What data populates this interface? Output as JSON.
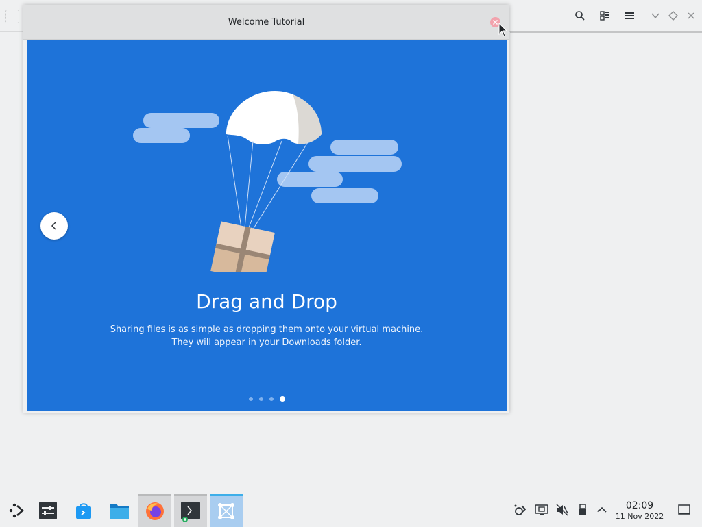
{
  "dialog": {
    "title": "Welcome Tutorial",
    "slide": {
      "title": "Drag and Drop",
      "description": "Sharing files is as simple as dropping them onto your virtual machine. They will appear in your Downloads folder."
    },
    "dots": {
      "count": 4,
      "active_index": 3
    }
  },
  "topbar": {
    "icons": [
      "search-icon",
      "grid-view-icon",
      "hamburger-menu-icon",
      "chevron-down-icon",
      "diamond-icon",
      "close-icon"
    ]
  },
  "taskbar": {
    "apps": [
      "application-launcher",
      "system-settings",
      "discover-store",
      "file-manager",
      "firefox",
      "terminal",
      "screenshot-tool"
    ],
    "clock": {
      "time": "02:09",
      "date": "11 Nov 2022"
    }
  },
  "colors": {
    "panel_blue": "#1e73d9",
    "cloud": "#a4c6f2",
    "box": "#d7b99c",
    "close_button": "#f2a3ad"
  }
}
